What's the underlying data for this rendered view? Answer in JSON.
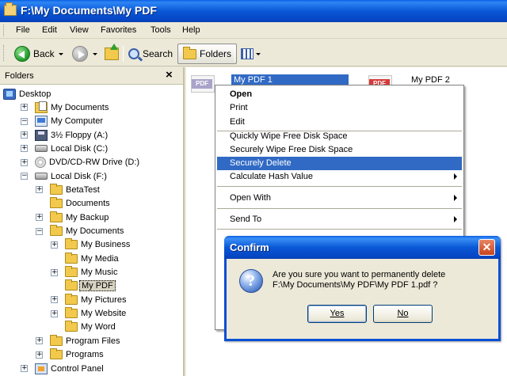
{
  "window": {
    "title": "F:\\My Documents\\My PDF"
  },
  "menubar": [
    "File",
    "Edit",
    "View",
    "Favorites",
    "Tools",
    "Help"
  ],
  "toolbar": {
    "back": "Back",
    "search": "Search",
    "folders": "Folders"
  },
  "folders_pane": {
    "title": "Folders",
    "close": "×",
    "tree": [
      {
        "label": "Desktop",
        "icon": "desktop-icon",
        "depth": 0
      },
      {
        "label": "My Documents",
        "icon": "my-documents-icon",
        "depth": 1,
        "toggle": "+"
      },
      {
        "label": "My Computer",
        "icon": "my-computer-icon",
        "depth": 1,
        "toggle": "−"
      },
      {
        "label": "3½ Floppy (A:)",
        "icon": "floppy-icon",
        "depth": 2,
        "toggle": "+"
      },
      {
        "label": "Local Disk (C:)",
        "icon": "hard-disk-icon",
        "depth": 2,
        "toggle": "+"
      },
      {
        "label": "DVD/CD-RW Drive (D:)",
        "icon": "dvd-drive-icon",
        "depth": 2,
        "toggle": "+"
      },
      {
        "label": "Local Disk (F:)",
        "icon": "hard-disk-icon",
        "depth": 2,
        "toggle": "−"
      },
      {
        "label": "BetaTest",
        "icon": "folder-icon",
        "depth": 3,
        "toggle": "+"
      },
      {
        "label": "Documents",
        "icon": "folder-icon",
        "depth": 3
      },
      {
        "label": "My Backup",
        "icon": "folder-icon",
        "depth": 3,
        "toggle": "+"
      },
      {
        "label": "My Documents",
        "icon": "folder-icon",
        "depth": 3,
        "toggle": "−"
      },
      {
        "label": "My Business",
        "icon": "folder-icon",
        "depth": 4,
        "toggle": "+"
      },
      {
        "label": "My Media",
        "icon": "folder-icon",
        "depth": 4
      },
      {
        "label": "My Music",
        "icon": "folder-icon",
        "depth": 4,
        "toggle": "+"
      },
      {
        "label": "My PDF",
        "icon": "folder-icon",
        "depth": 4,
        "selected": true
      },
      {
        "label": "My Pictures",
        "icon": "folder-icon",
        "depth": 4,
        "toggle": "+"
      },
      {
        "label": "My Website",
        "icon": "folder-icon",
        "depth": 4,
        "toggle": "+"
      },
      {
        "label": "My Word",
        "icon": "folder-icon",
        "depth": 4
      },
      {
        "label": "Program Files",
        "icon": "folder-icon",
        "depth": 3,
        "toggle": "+"
      },
      {
        "label": "Programs",
        "icon": "folder-icon",
        "depth": 3,
        "toggle": "+"
      },
      {
        "label": "Control Panel",
        "icon": "control-panel-icon",
        "depth": 2,
        "toggle": "+"
      }
    ]
  },
  "files": [
    {
      "name": "My PDF 1",
      "badge": "PDF",
      "selected": true
    },
    {
      "name": "My PDF 2",
      "badge": "PDF",
      "selected": false
    }
  ],
  "context_menu": [
    {
      "label": "Open",
      "bold": true
    },
    {
      "label": "Print"
    },
    {
      "label": "Edit"
    },
    {
      "label": "Quickly Wipe Free Disk Space"
    },
    {
      "label": "Securely Wipe Free Disk Space"
    },
    {
      "label": "Securely Delete",
      "highlighted": true
    },
    {
      "label": "Calculate Hash Value",
      "submenu": true
    },
    {
      "label": "Open With",
      "submenu": true
    },
    {
      "label": "Send To",
      "submenu": true
    }
  ],
  "dialog": {
    "title": "Confirm",
    "close": "✕",
    "icon": "question-icon",
    "message_line1": "Are you sure you want to permanently delete",
    "message_line2": "F:\\My Documents\\My PDF\\My PDF 1.pdf ?",
    "yes": "Yes",
    "no": "No"
  },
  "colors": {
    "title_blue": "#0a58d6",
    "selection": "#316ac5",
    "close_red": "#c9441d"
  }
}
